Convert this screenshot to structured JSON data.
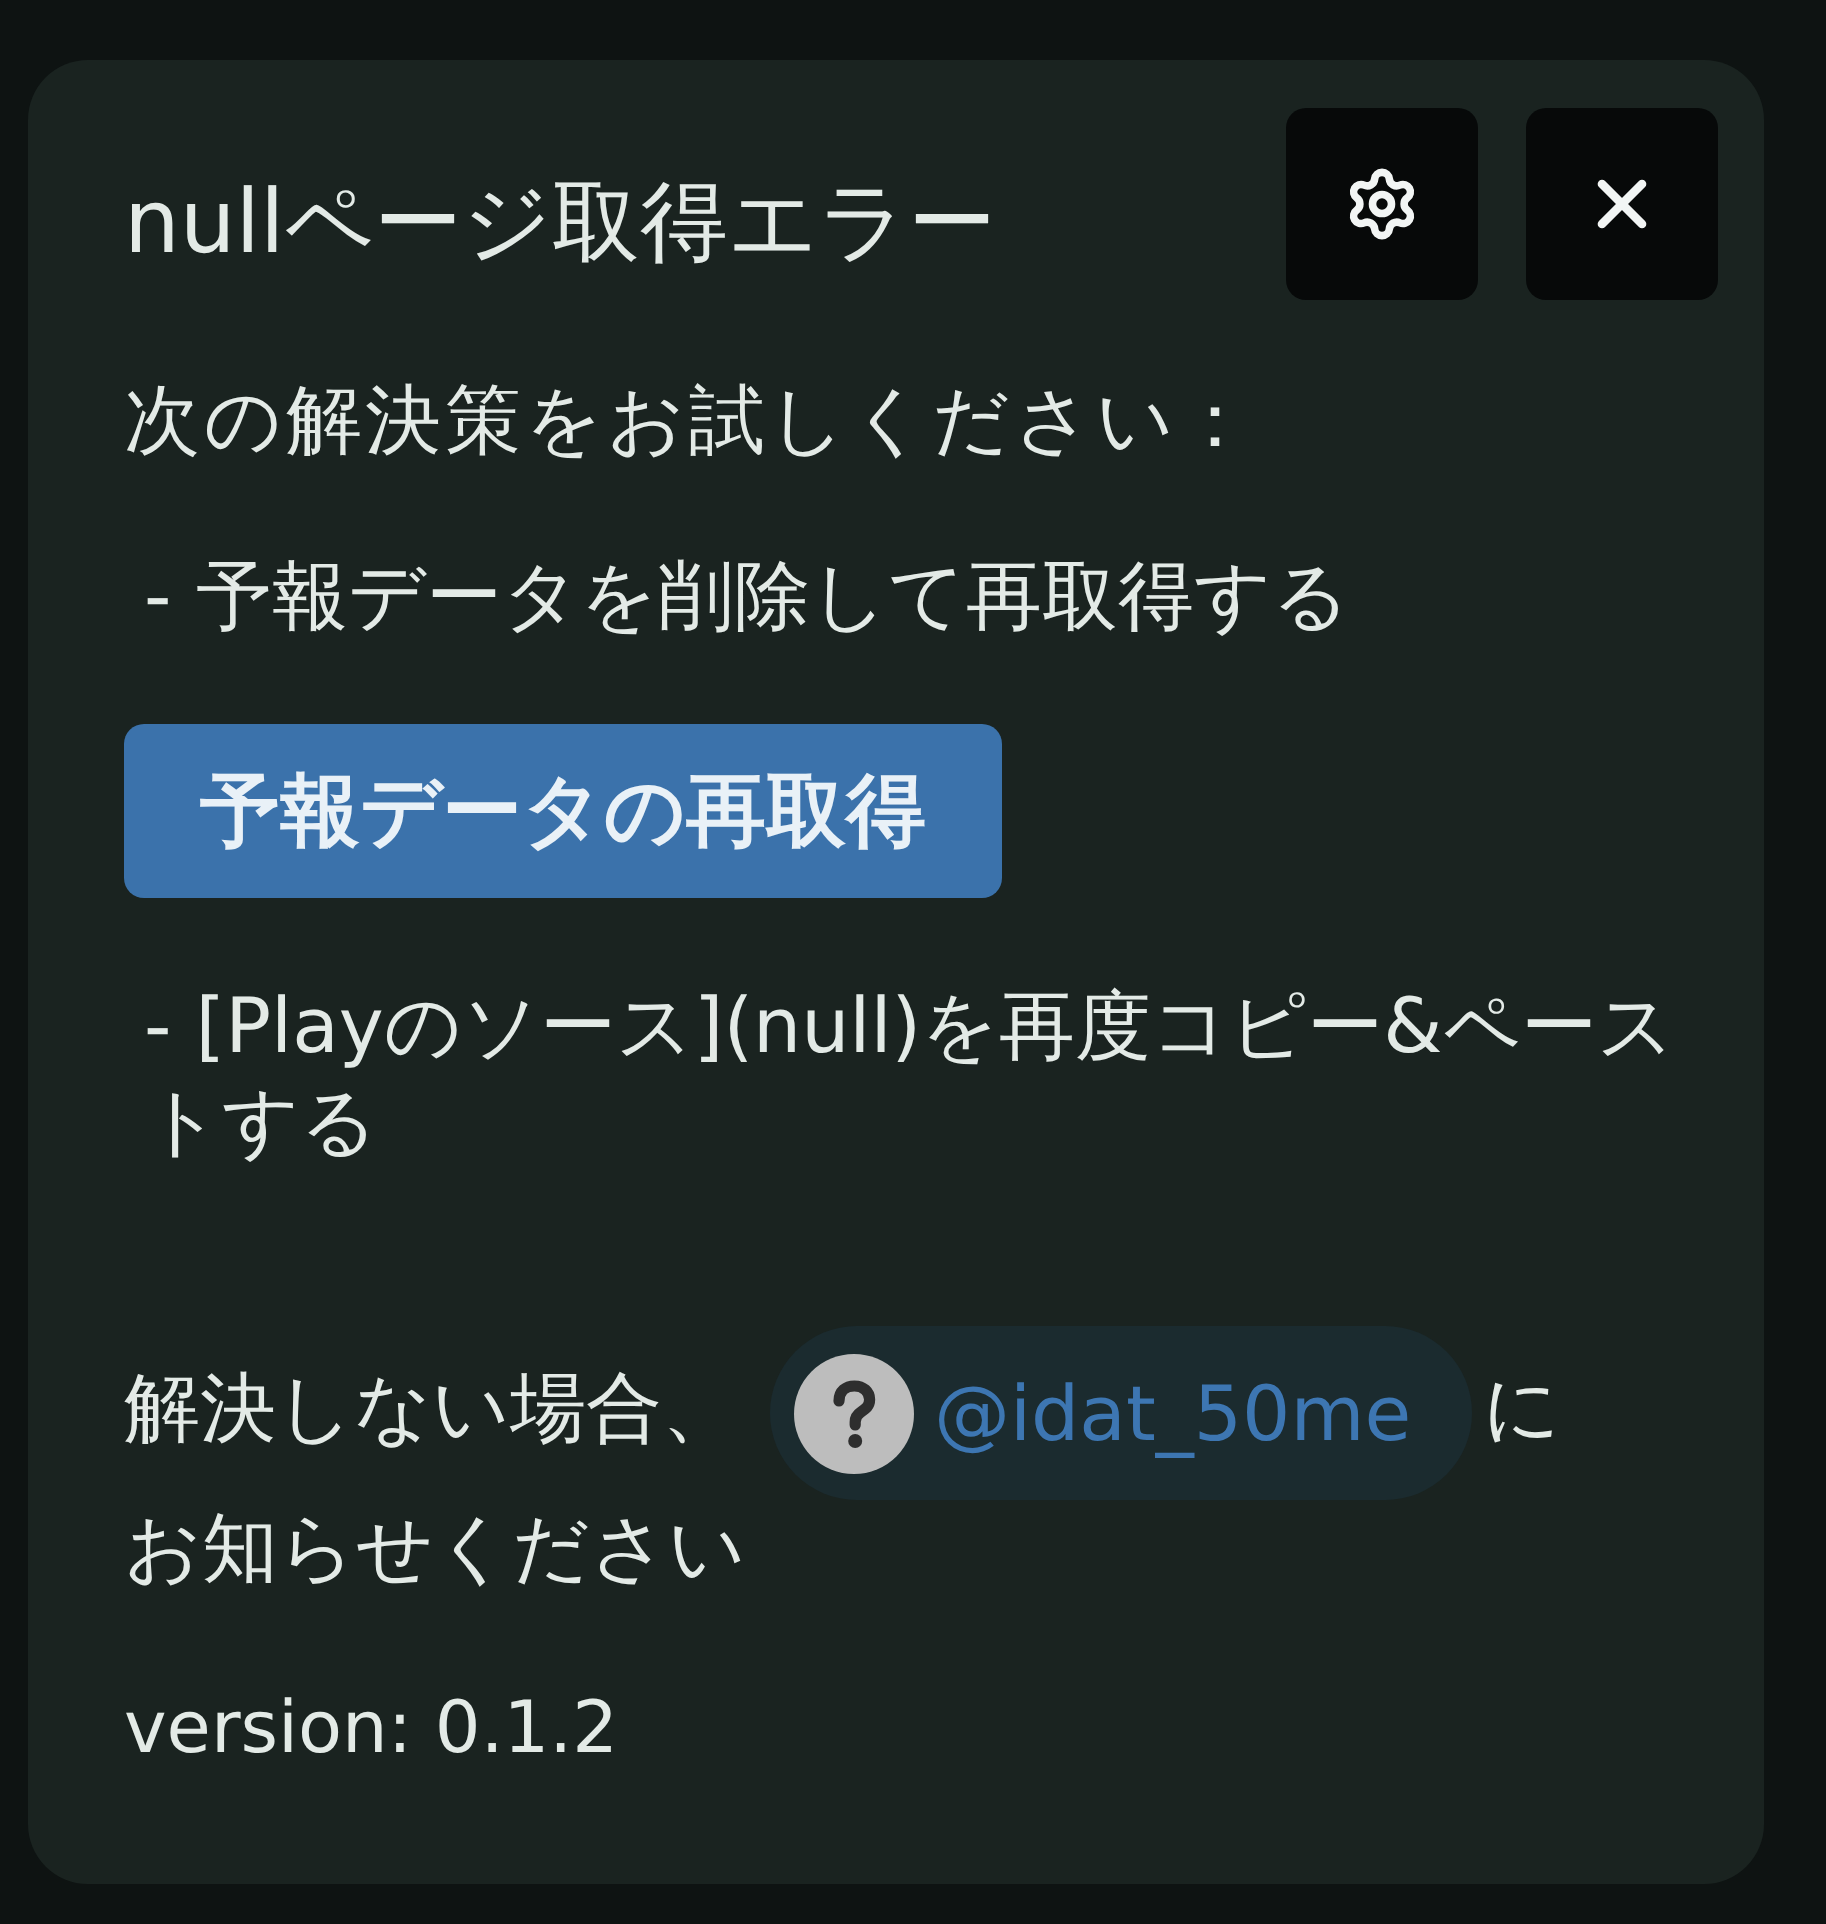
{
  "dialog": {
    "title": "nullページ取得エラー",
    "header_buttons": [
      {
        "kind": "settings"
      },
      {
        "kind": "close"
      }
    ],
    "intro": "次の解決策をお試しください：",
    "steps": [
      {
        "kind": "text",
        "text": "- 予報データを削除して再取得する"
      },
      {
        "kind": "button",
        "label": "予報データの再取得"
      },
      {
        "kind": "text",
        "text": "- [Playのソース](null)を再度コピー&ペーストする"
      }
    ],
    "contact": {
      "before": "解決しない場合、",
      "mention": "@idat_50me",
      "after": "にお知らせください"
    },
    "version": "version: 0.1.2"
  }
}
